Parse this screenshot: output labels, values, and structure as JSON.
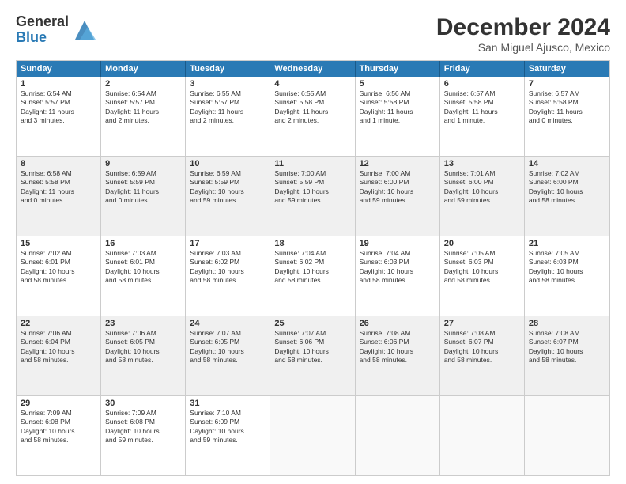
{
  "logo": {
    "general": "General",
    "blue": "Blue"
  },
  "title": "December 2024",
  "subtitle": "San Miguel Ajusco, Mexico",
  "days": [
    "Sunday",
    "Monday",
    "Tuesday",
    "Wednesday",
    "Thursday",
    "Friday",
    "Saturday"
  ],
  "weeks": [
    [
      {
        "day": "1",
        "lines": [
          "Sunrise: 6:54 AM",
          "Sunset: 5:57 PM",
          "Daylight: 11 hours",
          "and 3 minutes."
        ]
      },
      {
        "day": "2",
        "lines": [
          "Sunrise: 6:54 AM",
          "Sunset: 5:57 PM",
          "Daylight: 11 hours",
          "and 2 minutes."
        ]
      },
      {
        "day": "3",
        "lines": [
          "Sunrise: 6:55 AM",
          "Sunset: 5:57 PM",
          "Daylight: 11 hours",
          "and 2 minutes."
        ]
      },
      {
        "day": "4",
        "lines": [
          "Sunrise: 6:55 AM",
          "Sunset: 5:58 PM",
          "Daylight: 11 hours",
          "and 2 minutes."
        ]
      },
      {
        "day": "5",
        "lines": [
          "Sunrise: 6:56 AM",
          "Sunset: 5:58 PM",
          "Daylight: 11 hours",
          "and 1 minute."
        ]
      },
      {
        "day": "6",
        "lines": [
          "Sunrise: 6:57 AM",
          "Sunset: 5:58 PM",
          "Daylight: 11 hours",
          "and 1 minute."
        ]
      },
      {
        "day": "7",
        "lines": [
          "Sunrise: 6:57 AM",
          "Sunset: 5:58 PM",
          "Daylight: 11 hours",
          "and 0 minutes."
        ]
      }
    ],
    [
      {
        "day": "8",
        "lines": [
          "Sunrise: 6:58 AM",
          "Sunset: 5:58 PM",
          "Daylight: 11 hours",
          "and 0 minutes."
        ]
      },
      {
        "day": "9",
        "lines": [
          "Sunrise: 6:59 AM",
          "Sunset: 5:59 PM",
          "Daylight: 11 hours",
          "and 0 minutes."
        ]
      },
      {
        "day": "10",
        "lines": [
          "Sunrise: 6:59 AM",
          "Sunset: 5:59 PM",
          "Daylight: 10 hours",
          "and 59 minutes."
        ]
      },
      {
        "day": "11",
        "lines": [
          "Sunrise: 7:00 AM",
          "Sunset: 5:59 PM",
          "Daylight: 10 hours",
          "and 59 minutes."
        ]
      },
      {
        "day": "12",
        "lines": [
          "Sunrise: 7:00 AM",
          "Sunset: 6:00 PM",
          "Daylight: 10 hours",
          "and 59 minutes."
        ]
      },
      {
        "day": "13",
        "lines": [
          "Sunrise: 7:01 AM",
          "Sunset: 6:00 PM",
          "Daylight: 10 hours",
          "and 59 minutes."
        ]
      },
      {
        "day": "14",
        "lines": [
          "Sunrise: 7:02 AM",
          "Sunset: 6:00 PM",
          "Daylight: 10 hours",
          "and 58 minutes."
        ]
      }
    ],
    [
      {
        "day": "15",
        "lines": [
          "Sunrise: 7:02 AM",
          "Sunset: 6:01 PM",
          "Daylight: 10 hours",
          "and 58 minutes."
        ]
      },
      {
        "day": "16",
        "lines": [
          "Sunrise: 7:03 AM",
          "Sunset: 6:01 PM",
          "Daylight: 10 hours",
          "and 58 minutes."
        ]
      },
      {
        "day": "17",
        "lines": [
          "Sunrise: 7:03 AM",
          "Sunset: 6:02 PM",
          "Daylight: 10 hours",
          "and 58 minutes."
        ]
      },
      {
        "day": "18",
        "lines": [
          "Sunrise: 7:04 AM",
          "Sunset: 6:02 PM",
          "Daylight: 10 hours",
          "and 58 minutes."
        ]
      },
      {
        "day": "19",
        "lines": [
          "Sunrise: 7:04 AM",
          "Sunset: 6:03 PM",
          "Daylight: 10 hours",
          "and 58 minutes."
        ]
      },
      {
        "day": "20",
        "lines": [
          "Sunrise: 7:05 AM",
          "Sunset: 6:03 PM",
          "Daylight: 10 hours",
          "and 58 minutes."
        ]
      },
      {
        "day": "21",
        "lines": [
          "Sunrise: 7:05 AM",
          "Sunset: 6:03 PM",
          "Daylight: 10 hours",
          "and 58 minutes."
        ]
      }
    ],
    [
      {
        "day": "22",
        "lines": [
          "Sunrise: 7:06 AM",
          "Sunset: 6:04 PM",
          "Daylight: 10 hours",
          "and 58 minutes."
        ]
      },
      {
        "day": "23",
        "lines": [
          "Sunrise: 7:06 AM",
          "Sunset: 6:05 PM",
          "Daylight: 10 hours",
          "and 58 minutes."
        ]
      },
      {
        "day": "24",
        "lines": [
          "Sunrise: 7:07 AM",
          "Sunset: 6:05 PM",
          "Daylight: 10 hours",
          "and 58 minutes."
        ]
      },
      {
        "day": "25",
        "lines": [
          "Sunrise: 7:07 AM",
          "Sunset: 6:06 PM",
          "Daylight: 10 hours",
          "and 58 minutes."
        ]
      },
      {
        "day": "26",
        "lines": [
          "Sunrise: 7:08 AM",
          "Sunset: 6:06 PM",
          "Daylight: 10 hours",
          "and 58 minutes."
        ]
      },
      {
        "day": "27",
        "lines": [
          "Sunrise: 7:08 AM",
          "Sunset: 6:07 PM",
          "Daylight: 10 hours",
          "and 58 minutes."
        ]
      },
      {
        "day": "28",
        "lines": [
          "Sunrise: 7:08 AM",
          "Sunset: 6:07 PM",
          "Daylight: 10 hours",
          "and 58 minutes."
        ]
      }
    ],
    [
      {
        "day": "29",
        "lines": [
          "Sunrise: 7:09 AM",
          "Sunset: 6:08 PM",
          "Daylight: 10 hours",
          "and 58 minutes."
        ]
      },
      {
        "day": "30",
        "lines": [
          "Sunrise: 7:09 AM",
          "Sunset: 6:08 PM",
          "Daylight: 10 hours",
          "and 59 minutes."
        ]
      },
      {
        "day": "31",
        "lines": [
          "Sunrise: 7:10 AM",
          "Sunset: 6:09 PM",
          "Daylight: 10 hours",
          "and 59 minutes."
        ]
      },
      {
        "day": "",
        "lines": []
      },
      {
        "day": "",
        "lines": []
      },
      {
        "day": "",
        "lines": []
      },
      {
        "day": "",
        "lines": []
      }
    ]
  ]
}
